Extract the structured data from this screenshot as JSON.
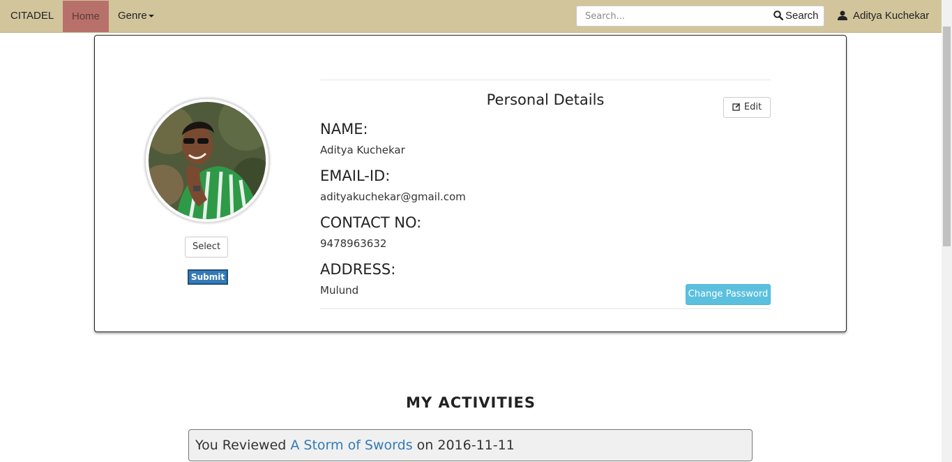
{
  "navbar": {
    "brand": "CITADEL",
    "home": "Home",
    "genre": "Genre",
    "search_placeholder": "Search...",
    "search_button": "Search",
    "user_name": "Aditya Kuchekar",
    "colors": {
      "bar": "#d2c59c",
      "active": "#b8716a"
    }
  },
  "profile": {
    "title": "Personal Details",
    "edit_label": "Edit",
    "select_label": "Select",
    "submit_label": "Submit",
    "change_password_label": "Change Password",
    "fields": [
      {
        "label": "NAME:",
        "value": "Aditya Kuchekar"
      },
      {
        "label": "EMAIL-ID:",
        "value": "adityakuchekar@gmail.com"
      },
      {
        "label": "CONTACT NO:",
        "value": "9478963632"
      },
      {
        "label": "ADDRESS:",
        "value": "Mulund"
      }
    ]
  },
  "activities": {
    "title": "MY ACTIVITIES",
    "items": [
      {
        "prefix": "You Reviewed",
        "book": "A Storm of Swords",
        "middle": "on",
        "date": "2016-11-11"
      }
    ]
  },
  "icons": {
    "search": "search-icon",
    "user": "user-icon",
    "edit": "edit-icon",
    "caret": "caret-down-icon"
  }
}
